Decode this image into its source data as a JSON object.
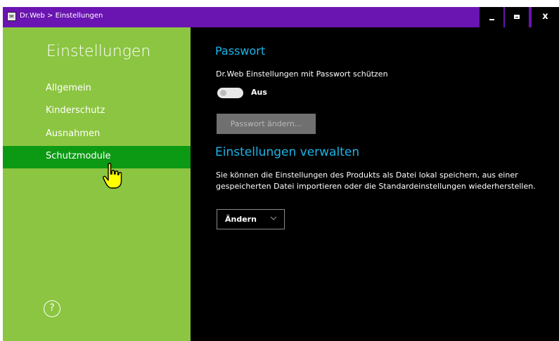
{
  "window": {
    "title": "Dr.Web > Einstellungen",
    "app_icon_glyph": "✉",
    "controls": {
      "minimize": "minimize-icon",
      "maximize": "maximize-icon",
      "close_glyph": "x"
    },
    "colors": {
      "titlebar": "#6a14b2",
      "sidebar": "#8cc541",
      "sidebar_active": "#0c9a15",
      "content_bg": "#000000",
      "accent": "#1cb4e6"
    }
  },
  "sidebar": {
    "title": "Einstellungen",
    "items": [
      {
        "label": "Allgemein",
        "active": false
      },
      {
        "label": "Kinderschutz",
        "active": false
      },
      {
        "label": "Ausnahmen",
        "active": false
      },
      {
        "label": "Schutzmodule",
        "active": true
      }
    ],
    "help_glyph": "?"
  },
  "password": {
    "title": "Passwort",
    "description": "Dr.Web Einstellungen mit Passwort schützen",
    "toggle_state": "Aus",
    "change_button": "Passwort ändern..."
  },
  "manage": {
    "title": "Einstellungen verwalten",
    "description_line1": "Sie können die Einstellungen des Produkts als Datei lokal speichern, aus einer",
    "description_line2": "gespeicherten Datei importieren oder die Standardeinstellungen wiederherstellen.",
    "dropdown_label": "Ändern"
  }
}
